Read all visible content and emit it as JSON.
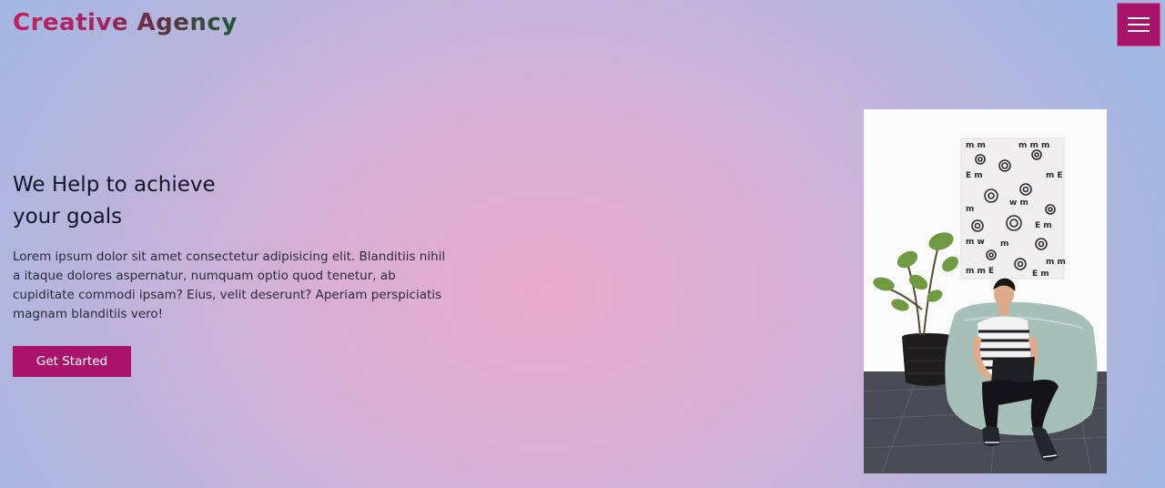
{
  "header": {
    "logo_text": "Creative Agency",
    "menu_icon": "hamburger-menu-icon"
  },
  "hero": {
    "title_line1": "We Help to achieve",
    "title_line2": "your goals",
    "description": "Lorem ipsum dolor sit amet consectetur adipisicing elit. Blanditiis nihil a itaque dolores aspernatur, numquam optio quod tenetur, ab cupiditate commodi ipsam? Eius, velit deserunt? Aperiam perspiciatis magnam blanditiis vero!",
    "cta_label": "Get Started",
    "image_subject": "man-on-beanbag-with-laptop"
  },
  "colors": {
    "accent": "#a8146a",
    "logo_start": "#c1205f",
    "logo_end": "#1e5a3a"
  }
}
